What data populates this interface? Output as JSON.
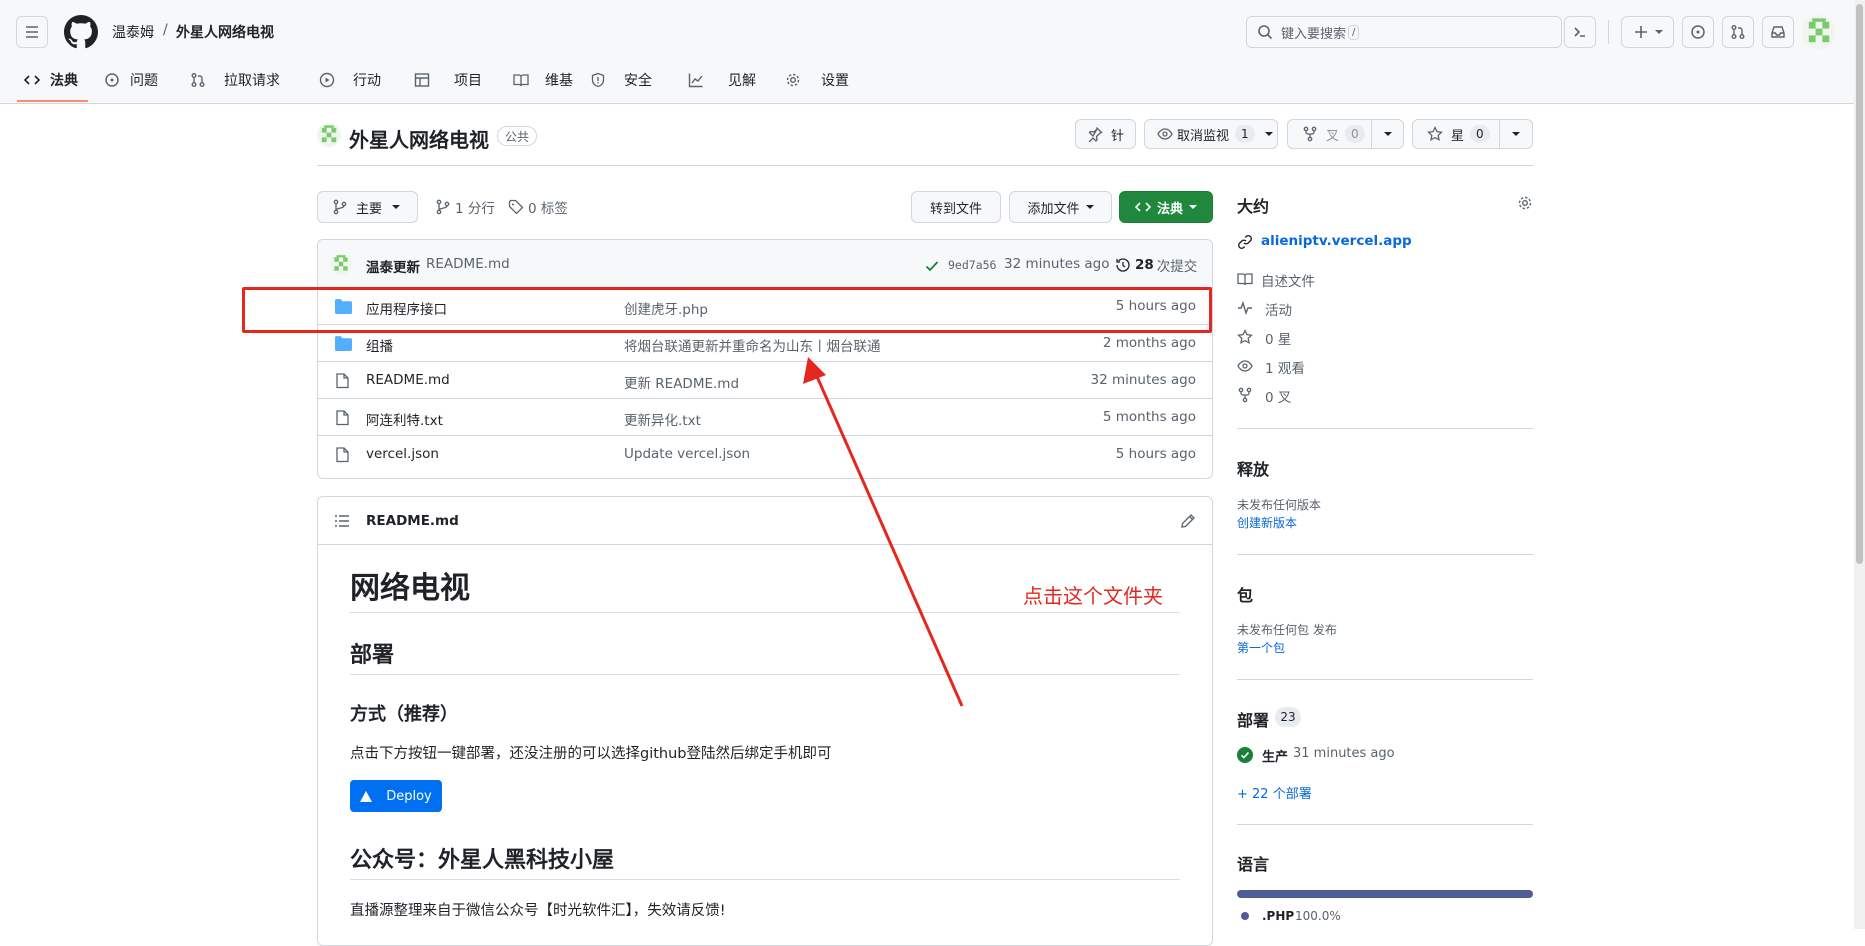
{
  "header": {
    "owner": "温泰姆",
    "repo": "外星人网络电视",
    "search_placeholder": "键入要搜索",
    "search_kbd": "/"
  },
  "tabs": [
    "法典",
    "问题",
    "拉取请求",
    "行动",
    "项目",
    "维基",
    "安全",
    "见解",
    "设置"
  ],
  "repo_head": {
    "title": "外星人网络电视",
    "visibility": "公共",
    "pin": "针",
    "watch": "取消监视",
    "watch_count": "1",
    "fork": "叉",
    "fork_count": "0",
    "star": "星",
    "star_count": "0"
  },
  "branchbar": {
    "branch": "主要",
    "branches": "1 分行",
    "tags": "0 标签",
    "goto_file": "转到文件",
    "add_file": "添加文件",
    "code": "法典"
  },
  "commit": {
    "author": "温泰更新",
    "message": "README.md",
    "sha": "9ed7a56",
    "time": "32 minutes ago",
    "count": "28",
    "count_label": "次提交"
  },
  "files": [
    {
      "type": "dir",
      "name": "应用程序接口",
      "message": "创建虎牙.php",
      "age": "5 hours ago"
    },
    {
      "type": "dir",
      "name": "组播",
      "message": "将烟台联通更新并重命名为山东丨烟台联通",
      "age": "2 months ago"
    },
    {
      "type": "file",
      "name": "README.md",
      "message": "更新 README.md",
      "age": "32 minutes ago"
    },
    {
      "type": "file",
      "name": "阿连利特.txt",
      "message": "更新异化.txt",
      "age": "5 months ago"
    },
    {
      "type": "file",
      "name": "vercel.json",
      "message": "Update vercel.json",
      "age": "5 hours ago"
    }
  ],
  "readme": {
    "file": "README.md",
    "h1": "网络电视",
    "h2": "部署",
    "h3": "方式（推荐）",
    "p1": "点击下方按钮一键部署，还没注册的可以选择github登陆然后绑定手机即可",
    "deploy": "Deploy",
    "h2b": "公众号：外星人黑科技小屋",
    "p2": "直播源整理来自于微信公众号【时光软件汇】，失效请反馈!"
  },
  "annotation": "点击这个文件夹",
  "sidebar": {
    "about": "大约",
    "link": "alieniptv.vercel.app",
    "readme": "自述文件",
    "activity": "活动",
    "stars": "0 星",
    "watching": "1 观看",
    "forks": "0 叉",
    "releases_h": "释放",
    "releases_none": "未发布任何版本",
    "releases_create": "创建新版本",
    "packages_h": "包",
    "packages_none": "未发布任何包 发布",
    "packages_first": "第一个包",
    "deploy_h": "部署",
    "deploy_count": "23",
    "deploy_env": "生产",
    "deploy_time": "31 minutes ago",
    "deploy_more": "+ 22 个部署",
    "lang_h": "语言",
    "lang_name": ".PHP",
    "lang_pct": "100.0%"
  },
  "colors": {
    "accent": "#0969da",
    "green": "#1f883d",
    "folder": "#54aeff",
    "highlight": "#e5281f",
    "lang_bar": "#4f5d95"
  }
}
